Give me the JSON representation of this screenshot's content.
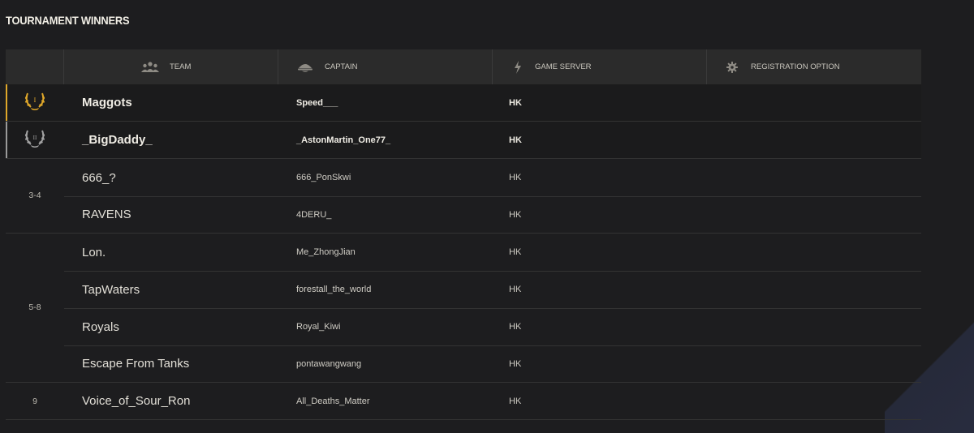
{
  "page": {
    "title": "TOURNAMENT WINNERS"
  },
  "header": {
    "columns": [
      {
        "label": "TEAM",
        "icon": "team-icon"
      },
      {
        "label": "CAPTAIN",
        "icon": "captain-icon"
      },
      {
        "label": "GAME SERVER",
        "icon": "lightning-icon"
      },
      {
        "label": "REGISTRATION OPTION",
        "icon": "gear-icon"
      }
    ]
  },
  "colors": {
    "gold": "#e0a82a",
    "silver": "#9a9a9a",
    "background": "#1d1d1f",
    "header": "#2b2b2b"
  },
  "winners": [
    {
      "place_icon": "laurel-gold-icon",
      "place_numeral": "I",
      "team": "Maggots",
      "captain": "Speed___",
      "server": "HK"
    },
    {
      "place_icon": "laurel-silver-icon",
      "place_numeral": "II",
      "team": "_BigDaddy_",
      "captain": "_AstonMartin_One77_",
      "server": "HK"
    }
  ],
  "groups": [
    {
      "place": "3-4",
      "rows": [
        {
          "team": "666_?",
          "captain": "666_PonSkwi",
          "server": "HK"
        },
        {
          "team": "RAVENS",
          "captain": "4DERU_",
          "server": "HK"
        }
      ]
    },
    {
      "place": "5-8",
      "rows": [
        {
          "team": "Lon.",
          "captain": "Me_ZhongJian",
          "server": "HK"
        },
        {
          "team": "TapWaters",
          "captain": "forestall_the_world",
          "server": "HK"
        },
        {
          "team": "Royals",
          "captain": "Royal_Kiwi",
          "server": "HK"
        },
        {
          "team": "Escape From Tanks",
          "captain": "pontawangwang",
          "server": "HK"
        }
      ]
    },
    {
      "place": "9",
      "rows": [
        {
          "team": "Voice_of_Sour_Ron",
          "captain": "All_Deaths_Matter",
          "server": "HK"
        }
      ]
    }
  ]
}
